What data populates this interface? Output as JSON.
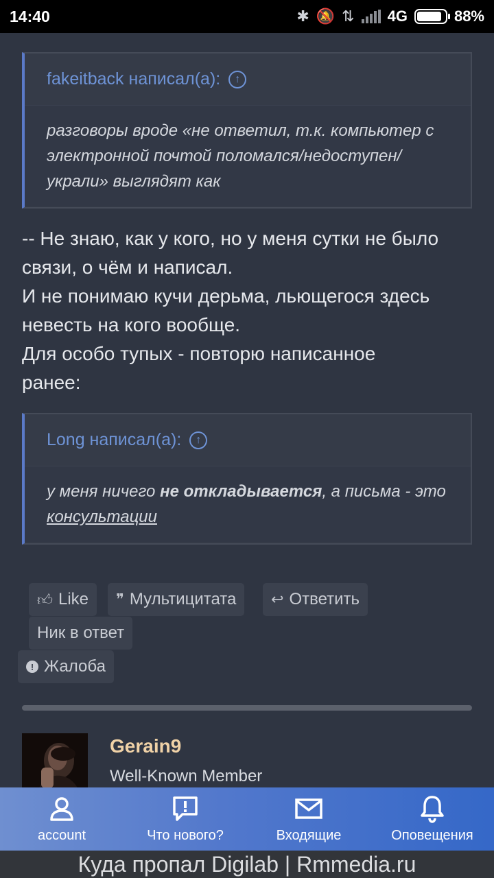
{
  "status_bar": {
    "time": "14:40",
    "network": "4G",
    "battery": "88%",
    "battery_level": 0.88
  },
  "quotes": [
    {
      "author_line": "fakeitback написал(а):",
      "text": "разговоры вроде «не ответил, т.к. компьютер с электронной почтой поломался/недоступен/ украли» выглядят как"
    },
    {
      "author_line": "Long написал(а):",
      "text_before": "у меня ничего ",
      "text_bold": "не откладывается",
      "text_after": ", а письма - это ",
      "text_underlined": "консультации"
    }
  ],
  "post_text": [
    "-- Не знаю, как у кого, но у меня сутки не было",
    "связи, о чём и написал.",
    "И не понимаю кучи дерьма, льющегося здесь",
    "невесть на кого вообще.",
    "Для особо тупых - повторю написанное",
    "ранее:"
  ],
  "actions": {
    "like": "Like",
    "multiquote": "Мультицитата",
    "reply": "Ответить",
    "nick_reply": "Ник в ответ",
    "report": "Жалоба"
  },
  "next_post": {
    "username": "Gerain9",
    "user_title": "Well-Known Member"
  },
  "bottom_nav": [
    {
      "label": "account",
      "icon": "account-icon"
    },
    {
      "label": "Что нового?",
      "icon": "whats-new-icon"
    },
    {
      "label": "Входящие",
      "icon": "inbox-icon"
    },
    {
      "label": "Оповещения",
      "icon": "bell-icon"
    }
  ],
  "caption": "Куда пропал Digilab | Rmmedia.ru",
  "colors": {
    "background": "#2f3542",
    "quote_accent": "#5b7ac8",
    "link": "#6e93d6",
    "username": "#f0d2a7",
    "nav_start": "#6f8fd0",
    "nav_end": "#3568c8"
  }
}
